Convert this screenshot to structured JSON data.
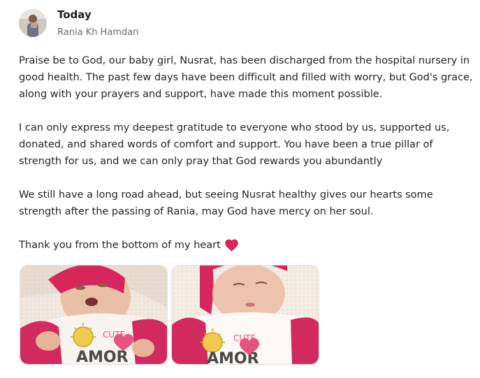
{
  "post": {
    "title": "Today",
    "author": "Rania Kh Hamdan",
    "paragraphs": [
      "Praise be to God, our baby girl, Nusrat, has been discharged from the hospital nursery in good health. The past few days have been difficult and filled with worry, but God's grace, along with your prayers and support, have made this moment possible.",
      "I can only express my deepest gratitude to everyone who stood by us, supported us, donated, and shared words of comfort and support. You have been a true pillar of strength for us, and we can only pray that God rewards you abundantly",
      "We still have a long road ahead, but seeing Nusrat healthy gives our hearts some strength after the passing of Rania, may God have mercy on her soul."
    ],
    "closing": "Thank you from the bottom of my heart",
    "closing_icon": "heart-icon",
    "accent_color": "#e0245e"
  },
  "photos": [
    {
      "name": "baby-photo-1",
      "shirt_text": [
        "CUTE",
        "AMOR"
      ]
    },
    {
      "name": "baby-photo-2",
      "shirt_text": [
        "CUTE",
        "AMOR"
      ]
    }
  ]
}
